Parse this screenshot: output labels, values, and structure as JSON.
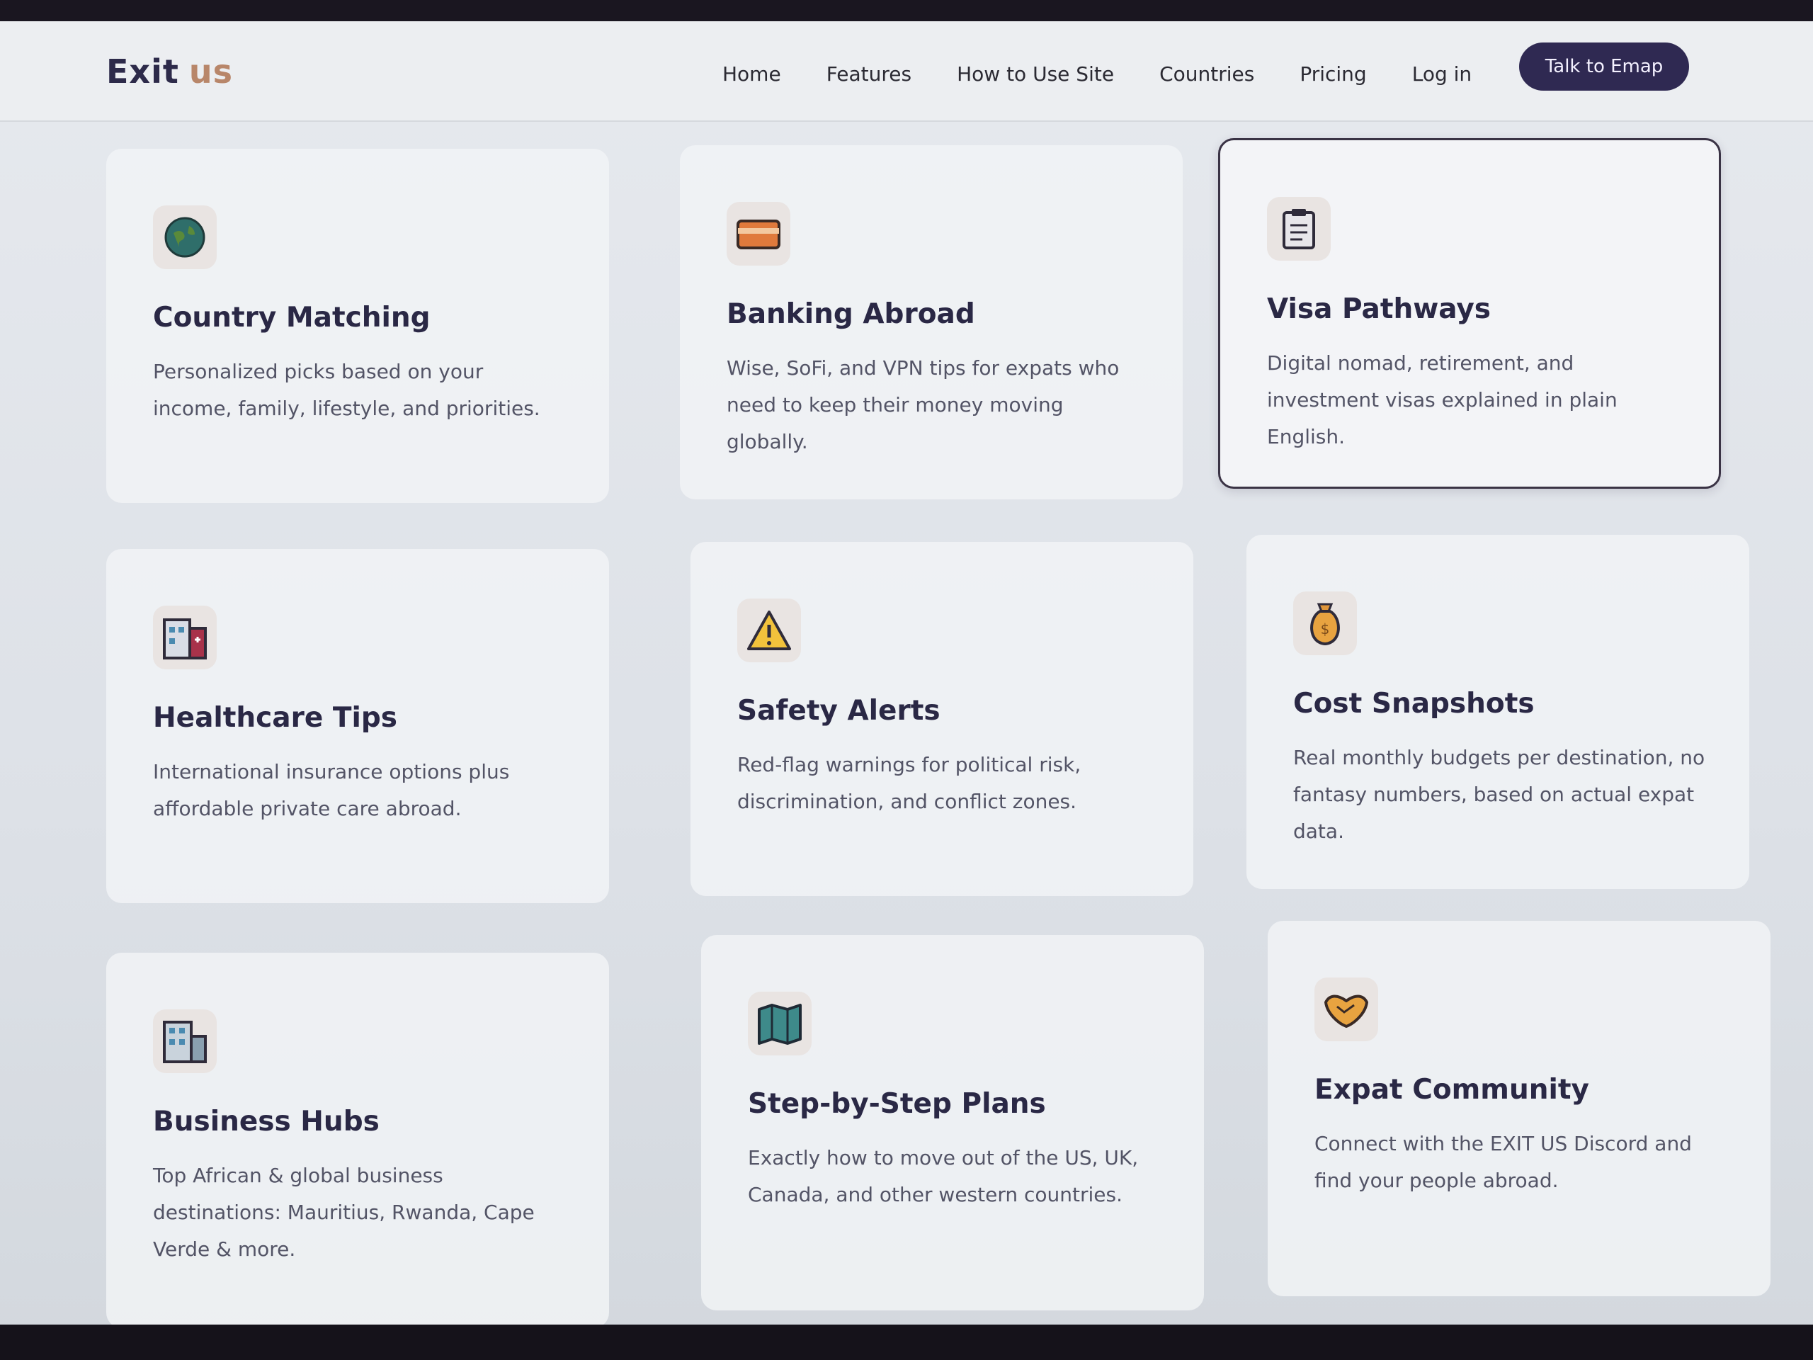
{
  "logo": {
    "word1": "Exit",
    "word2": "us"
  },
  "nav": {
    "links": [
      "Home",
      "Features",
      "How to Use Site",
      "Countries",
      "Pricing",
      "Log in"
    ],
    "cta": "Talk to Emap"
  },
  "features": [
    {
      "title": "Country Matching",
      "desc": "Personalized picks based on your income, family, lifestyle, and priorities.",
      "icon": "globe-icon"
    },
    {
      "title": "Banking Abroad",
      "desc": "Wise, SoFi, and VPN tips for expats who need to keep their money moving globally.",
      "icon": "credit-card-icon"
    },
    {
      "title": "Visa Pathways",
      "desc": "Digital nomad, retirement, and investment visas explained in plain English.",
      "icon": "clipboard-icon"
    },
    {
      "title": "Healthcare Tips",
      "desc": "International insurance options plus affordable private care abroad.",
      "icon": "hospital-icon"
    },
    {
      "title": "Safety Alerts",
      "desc": "Red-flag warnings for political risk, discrimination, and conflict zones.",
      "icon": "warning-icon"
    },
    {
      "title": "Cost Snapshots",
      "desc": "Real monthly budgets per destination, no fantasy numbers, based on actual expat data.",
      "icon": "money-bag-icon"
    },
    {
      "title": "Business Hubs",
      "desc": "Top African & global business destinations: Mauritius, Rwanda, Cape Verde & more.",
      "icon": "office-building-icon"
    },
    {
      "title": "Step-by-Step Plans",
      "desc": "Exactly how to move out of the US, UK, Canada, and other western countries.",
      "icon": "map-icon"
    },
    {
      "title": "Expat Community",
      "desc": "Connect with the EXIT US Discord and find your people abroad.",
      "icon": "handshake-icon"
    }
  ],
  "colors": {
    "brand_dark": "#2d2a4a",
    "brand_accent": "#b8866a",
    "cta_bg": "#2f2952"
  }
}
